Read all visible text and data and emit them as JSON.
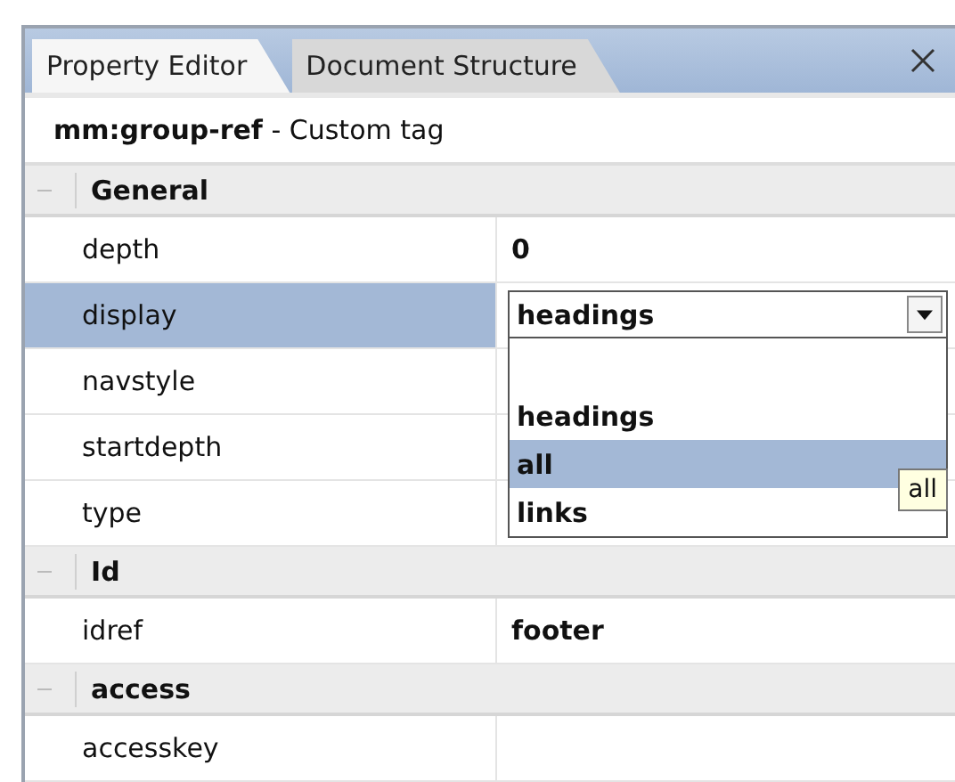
{
  "tabs": [
    {
      "label": "Property Editor",
      "selected": true
    },
    {
      "label": "Document Structure",
      "selected": false
    }
  ],
  "header": "**mm:group-ref** - Custom tag",
  "sections": [
    {
      "title": "General",
      "expanded": true,
      "properties": [
        {
          "name": "depth",
          "value": "0",
          "selected": false
        },
        {
          "name": "display",
          "value": "headings",
          "selected": true,
          "dropdown": {
            "open": true,
            "options": [
              {
                "label": "headings",
                "selected": false
              },
              {
                "label": "all",
                "selected": true
              },
              {
                "label": "links",
                "selected": false
              }
            ],
            "tooltip": "all"
          }
        },
        {
          "name": "navstyle",
          "selected": false
        },
        {
          "name": "startdepth",
          "selected": false
        },
        {
          "name": "type",
          "selected": false
        }
      ]
    },
    {
      "title": "Id",
      "expanded": true,
      "properties": [
        {
          "name": "idref",
          "value": "footer",
          "selected": false
        }
      ]
    },
    {
      "title": "access",
      "expanded": true,
      "properties": [
        {
          "name": "accesskey",
          "selected": false
        }
      ]
    }
  ]
}
